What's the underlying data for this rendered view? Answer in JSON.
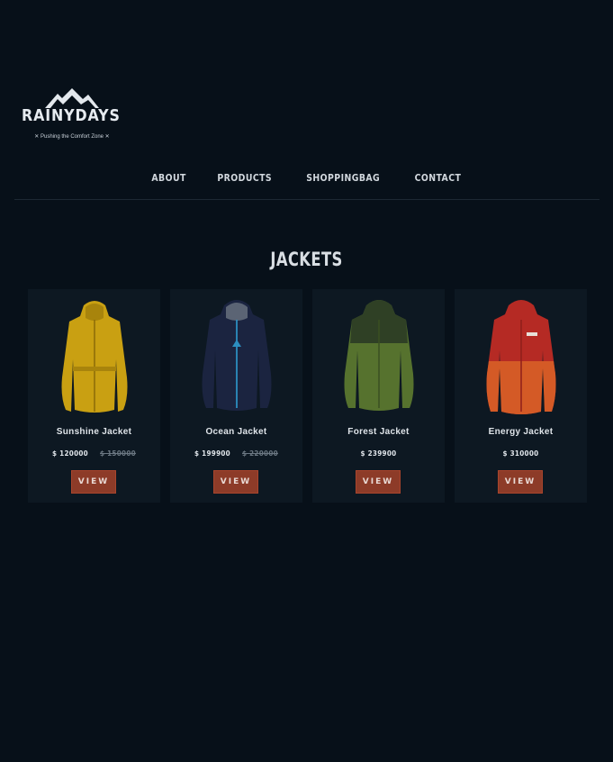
{
  "brand": {
    "name": "RAINYDAYS",
    "tagline": "✕ Pushing the Comfort Zone ✕"
  },
  "nav": {
    "items": [
      "ABOUT",
      "PRODUCTS",
      "SHOPPINGBAG",
      "CONTACT"
    ]
  },
  "page_title": "JACKETS",
  "products": [
    {
      "name": "Sunshine Jacket",
      "price": "$ 120000",
      "old_price": "$ 150000",
      "button": "VIEW",
      "icon": "yellow-jacket-image",
      "color": "#c9a012"
    },
    {
      "name": "Ocean Jacket",
      "price": "$ 199900",
      "old_price": "$ 220000",
      "button": "VIEW",
      "icon": "navy-jacket-image",
      "color": "#1b2440"
    },
    {
      "name": "Forest Jacket",
      "price": "$ 239900",
      "old_price": "",
      "button": "VIEW",
      "icon": "green-jacket-image",
      "color": "#56722e"
    },
    {
      "name": "Energy Jacket",
      "price": "$ 310000",
      "old_price": "",
      "button": "VIEW",
      "icon": "red-jacket-image",
      "color": "#b52a24"
    }
  ],
  "colors": {
    "background": "#071019",
    "card": "#0d1822",
    "button": "#8d3b28"
  }
}
